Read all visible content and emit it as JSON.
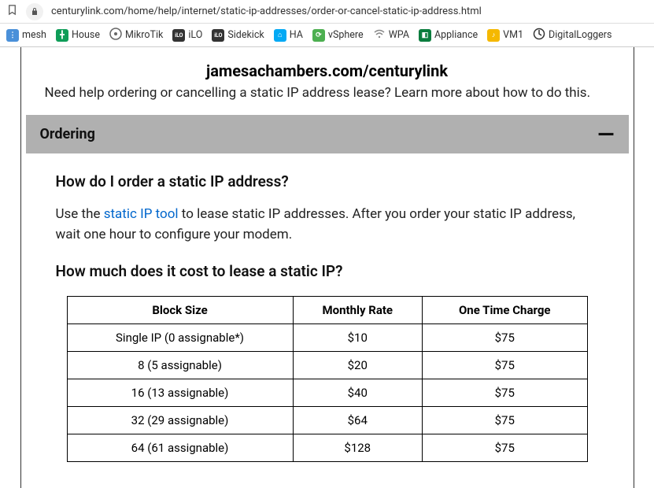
{
  "browser": {
    "url": "centurylink.com/home/help/internet/static-ip-addresses/order-or-cancel-static-ip-address.html"
  },
  "bookmarks": [
    {
      "label": "mesh"
    },
    {
      "label": "House"
    },
    {
      "label": "MikroTik"
    },
    {
      "label": "iLO"
    },
    {
      "label": "Sidekick"
    },
    {
      "label": "HA"
    },
    {
      "label": "vSphere"
    },
    {
      "label": "WPA"
    },
    {
      "label": "Appliance"
    },
    {
      "label": "VM1"
    },
    {
      "label": "DigitalLoggers"
    }
  ],
  "page": {
    "watermark": "jamesachambers.com/centurylink",
    "lead": "Need help ordering or cancelling a static IP address lease? Learn more about how to do this.",
    "accordion_title": "Ordering",
    "q1": "How do I order a static IP address?",
    "para_prefix": "Use the ",
    "para_link": "static IP tool",
    "para_suffix": " to lease static IP addresses. After you order your static IP address, wait one hour to configure your modem.",
    "q2": "How much does it cost to lease a static IP?",
    "table": {
      "headers": [
        "Block Size",
        "Monthly Rate",
        "One Time Charge"
      ],
      "rows": [
        [
          "Single IP (0 assignable*)",
          "$10",
          "$75"
        ],
        [
          "8 (5 assignable)",
          "$20",
          "$75"
        ],
        [
          "16 (13 assignable)",
          "$40",
          "$75"
        ],
        [
          "32 (29 assignable)",
          "$64",
          "$75"
        ],
        [
          "64 (61 assignable)",
          "$128",
          "$75"
        ]
      ]
    }
  }
}
